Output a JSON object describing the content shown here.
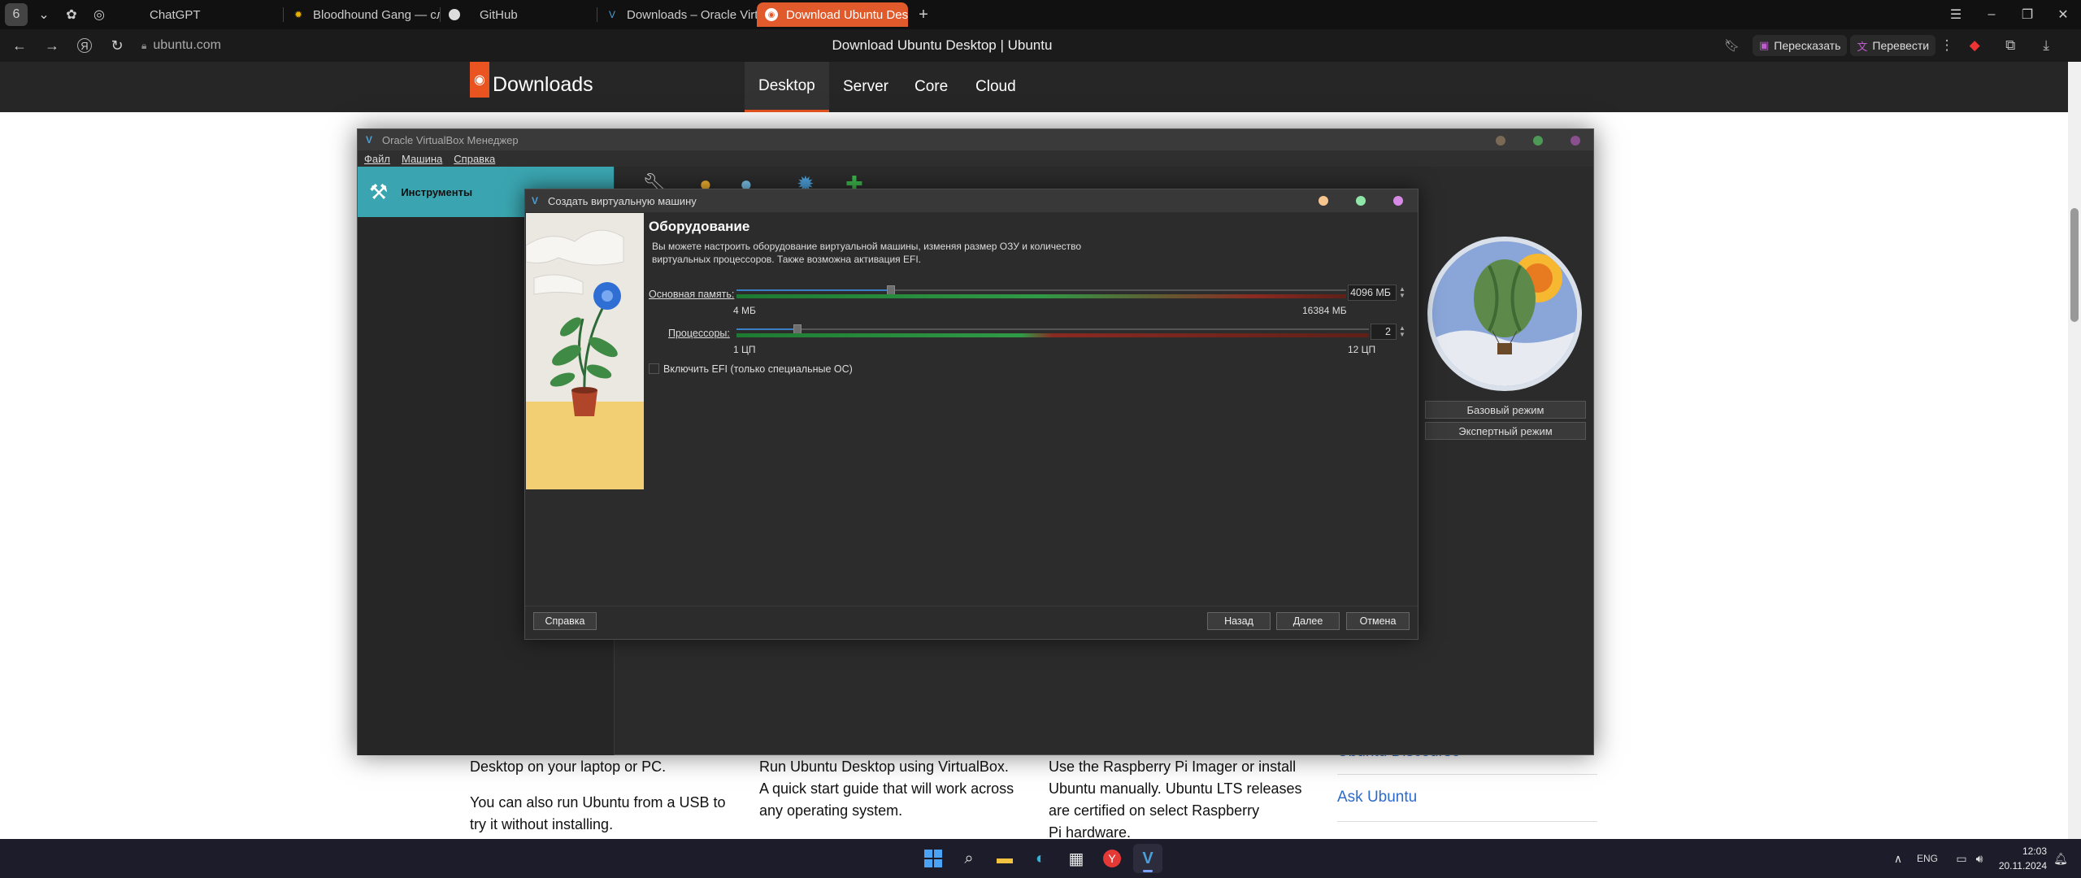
{
  "browser": {
    "tabs": [
      {
        "label": "ChatGPT",
        "icon": "chatgpt-icon",
        "active": false
      },
      {
        "label": "Bloodhound Gang — слуш",
        "icon": "sun-icon",
        "active": false
      },
      {
        "label": "GitHub",
        "icon": "github-icon",
        "active": false
      },
      {
        "label": "Downloads – Oracle Virtu",
        "icon": "oracle-icon",
        "active": false
      },
      {
        "label": "Download Ubuntu Deskt",
        "icon": "ubuntu-icon",
        "active": true
      }
    ],
    "url_domain": "ubuntu.com",
    "page_title": "Download Ubuntu Desktop | Ubuntu",
    "retell_label": "Пересказать",
    "translate_label": "Перевести",
    "accent": "#e05a2b"
  },
  "ubuntu_page": {
    "section_title": "Downloads",
    "nav": [
      "Desktop",
      "Server",
      "Core",
      "Cloud"
    ],
    "active_nav": "Desktop",
    "col1_line1": "Desktop on your laptop or PC.",
    "col1_line2a": "You can also run Ubuntu from a USB to",
    "col1_line2b": "try it without installing.",
    "col2_line1": "Run Ubuntu Desktop using VirtualBox.",
    "col2_line2": "A quick start guide that will work across",
    "col2_line3": "any operating system.",
    "col3_line1": "Use the Raspberry Pi Imager or install",
    "col3_line2": "Ubuntu manually. Ubuntu LTS releases",
    "col3_line3": "are certified on select Raspberry",
    "col3_line4": "Pi hardware.",
    "link_discourse": "Ubuntu Discourse",
    "link_ask": "Ask Ubuntu"
  },
  "vbox": {
    "title": "Oracle VirtualBox Менеджер",
    "menu": [
      "Файл",
      "Машина",
      "Справка"
    ],
    "tools_label": "Инструменты",
    "basic_mode": "Базовый режим",
    "expert_mode": "Экспертный режим"
  },
  "dialog": {
    "title": "Создать виртуальную машину",
    "heading": "Оборудование",
    "description": "Вы можете настроить оборудование виртуальной машины, изменяя размер ОЗУ и количество виртуальных процессоров. Также возможна активация EFI.",
    "memory": {
      "label": "Основная память:",
      "value": "4096 МБ",
      "min_label": "4 МБ",
      "max_label": "16384 МБ",
      "fraction": 0.25
    },
    "cpu": {
      "label": "Процессоры:",
      "value": "2",
      "min_label": "1 ЦП",
      "max_label": "12 ЦП",
      "fraction": 0.0909
    },
    "efi_label": "Включить EFI (только специальные ОС)",
    "efi_checked": false,
    "help_button": "Справка",
    "back_button": "Назад",
    "next_button": "Далее",
    "cancel_button": "Отмена"
  },
  "taskbar": {
    "lang": "ENG",
    "time": "12:03",
    "date": "20.11.2024"
  }
}
